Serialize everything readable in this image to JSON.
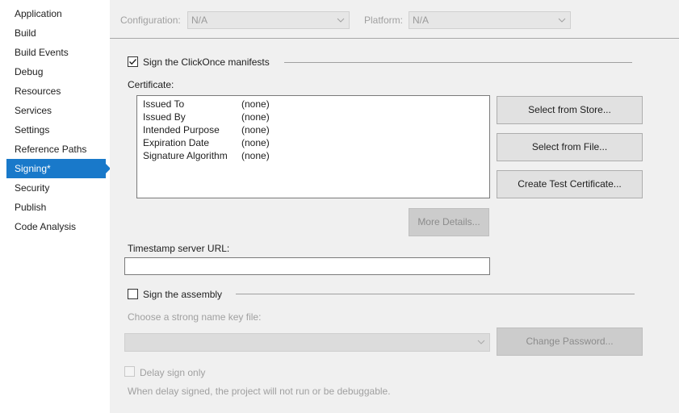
{
  "sidebar": {
    "items": [
      {
        "label": "Application"
      },
      {
        "label": "Build"
      },
      {
        "label": "Build Events"
      },
      {
        "label": "Debug"
      },
      {
        "label": "Resources"
      },
      {
        "label": "Services"
      },
      {
        "label": "Settings"
      },
      {
        "label": "Reference Paths"
      },
      {
        "label": "Signing*",
        "active": true
      },
      {
        "label": "Security"
      },
      {
        "label": "Publish"
      },
      {
        "label": "Code Analysis"
      }
    ]
  },
  "config_bar": {
    "configuration_label": "Configuration:",
    "configuration_value": "N/A",
    "platform_label": "Platform:",
    "platform_value": "N/A"
  },
  "signing": {
    "sign_manifests_label": "Sign the ClickOnce manifests",
    "sign_manifests_checked": true,
    "certificate_label": "Certificate:",
    "certificate_fields": [
      {
        "key": "Issued To",
        "value": "(none)"
      },
      {
        "key": "Issued By",
        "value": "(none)"
      },
      {
        "key": "Intended Purpose",
        "value": "(none)"
      },
      {
        "key": "Expiration Date",
        "value": "(none)"
      },
      {
        "key": "Signature Algorithm",
        "value": "(none)"
      }
    ],
    "select_from_store": "Select from Store...",
    "select_from_file": "Select from File...",
    "create_test_certificate": "Create Test Certificate...",
    "more_details": "More Details...",
    "timestamp_label": "Timestamp server URL:",
    "timestamp_value": "",
    "sign_assembly_label": "Sign the assembly",
    "sign_assembly_checked": false,
    "strong_name_label": "Choose a strong name key file:",
    "strong_name_value": "",
    "change_password": "Change Password...",
    "delay_sign_label": "Delay sign only",
    "delay_sign_note": "When delay signed, the project will not run or be debuggable."
  },
  "colors": {
    "accent": "#1979ca",
    "panel_bg": "#f0f0f0"
  }
}
